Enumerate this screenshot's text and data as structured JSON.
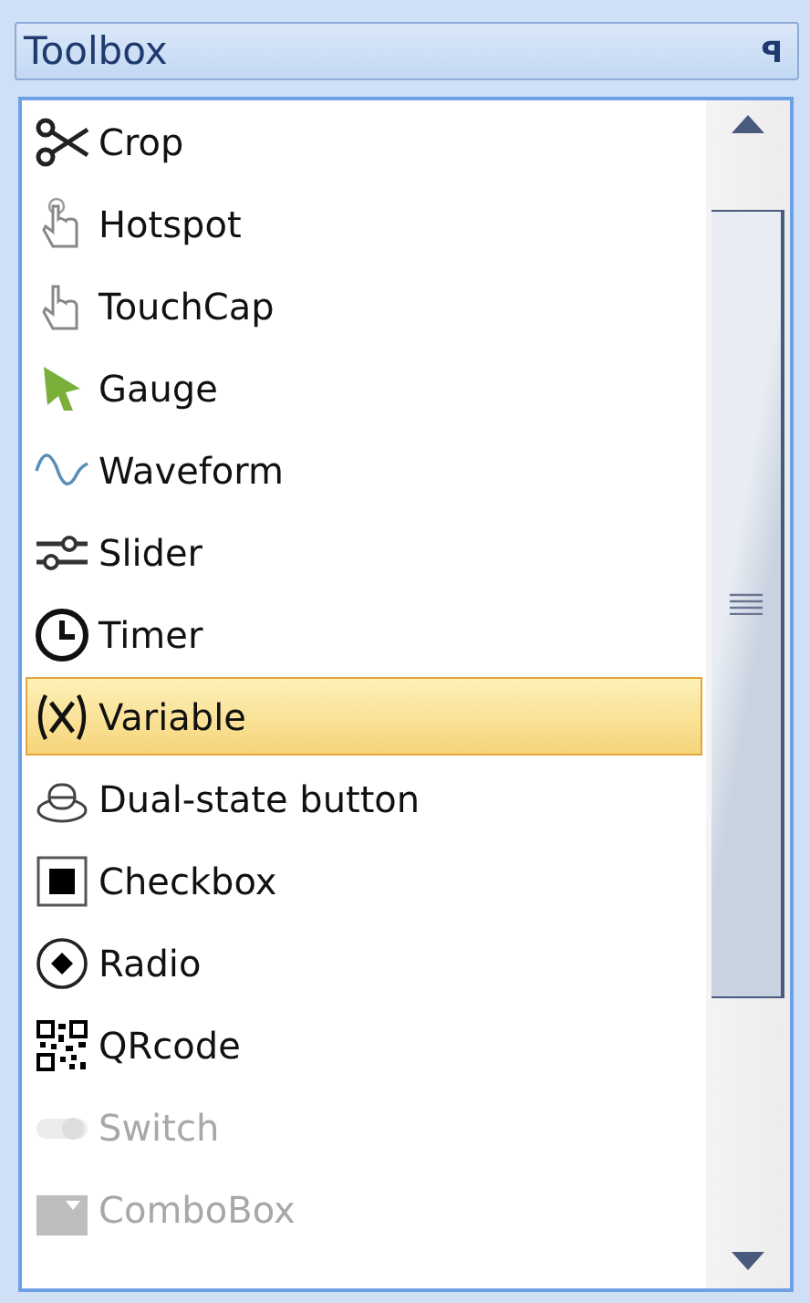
{
  "panel": {
    "title": "Toolbox",
    "pin": "ꟼ"
  },
  "items": [
    {
      "label": "Crop",
      "selected": false,
      "disabled": false
    },
    {
      "label": "Hotspot",
      "selected": false,
      "disabled": false
    },
    {
      "label": "TouchCap",
      "selected": false,
      "disabled": false
    },
    {
      "label": "Gauge",
      "selected": false,
      "disabled": false
    },
    {
      "label": "Waveform",
      "selected": false,
      "disabled": false
    },
    {
      "label": "Slider",
      "selected": false,
      "disabled": false
    },
    {
      "label": "Timer",
      "selected": false,
      "disabled": false
    },
    {
      "label": "Variable",
      "selected": true,
      "disabled": false
    },
    {
      "label": "Dual-state button",
      "selected": false,
      "disabled": false
    },
    {
      "label": "Checkbox",
      "selected": false,
      "disabled": false
    },
    {
      "label": "Radio",
      "selected": false,
      "disabled": false
    },
    {
      "label": "QRcode",
      "selected": false,
      "disabled": false
    },
    {
      "label": "Switch",
      "selected": false,
      "disabled": true
    },
    {
      "label": "ComboBox",
      "selected": false,
      "disabled": true
    }
  ]
}
